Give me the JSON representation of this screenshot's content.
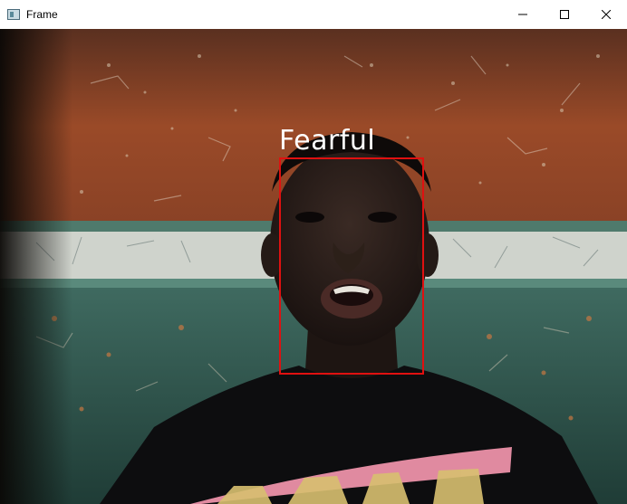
{
  "window": {
    "title": "Frame",
    "icon": "app-window-icon",
    "controls": [
      "minimize-icon",
      "maximize-icon",
      "close-icon"
    ]
  },
  "detection": {
    "label": "Fearful",
    "box_color": "#e01010",
    "label_color": "#ffffff"
  }
}
